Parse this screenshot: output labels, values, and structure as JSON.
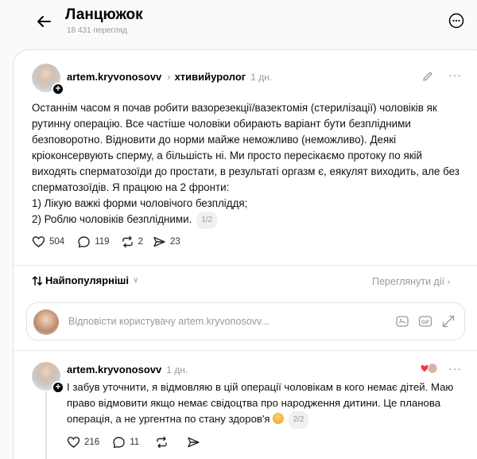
{
  "header": {
    "title": "Ланцюжок",
    "views": "18 431 перегляд"
  },
  "post": {
    "username": "artem.kryvonosovv",
    "topic": "хтивийуролог",
    "time": "1 дн.",
    "paragraphs": [
      "Останнім часом я почав робити вазорезекції/вазектомія (стерилізації) чоловіків як рутинну операцію. Все частіше чоловіки обирають варіант бути безплідними безповоротно. Відновити до норми майже неможливо (неможливо). Деякі кріоконсервують сперму, а більшість ні. Ми просто пересікаємо протоку по якій виходять сперматозоїди до простати, в результаті оргазм є, еякулят виходить, але без сперматозоїдів. Я працюю на 2 фронти:",
      "1) Лікую важкі форми чоловічого безпліддя;",
      "2) Роблю чоловіків безплідними."
    ],
    "pager": "1/2",
    "likes": "504",
    "comments": "119",
    "reposts": "2",
    "shares": "23"
  },
  "sort": {
    "label": "Найпопулярніші",
    "activity_link": "Переглянути дії"
  },
  "reply": {
    "placeholder": "Відповісти користувачу artem.kryvonosovv..."
  },
  "comment": {
    "username": "artem.kryvonosovv",
    "time": "1 дн.",
    "text": "І забув уточнити, я відмовляю в цій операції чоловікам в кого немає дітей. Маю право відмовити якщо немає свідоцтва про народження дитини. Це планова операція, а не ургентна по стану здоров'я",
    "pager": "2/2",
    "likes": "216",
    "comments": "11"
  },
  "icons": {
    "back": "arrow-left-icon",
    "more": "more-circle-icon",
    "edit": "pencil-icon",
    "like": "heart-icon",
    "comment": "comment-bubble-icon",
    "repost": "repost-icon",
    "share": "send-icon",
    "sort": "sort-arrows-icon",
    "image": "image-icon",
    "gif": "gif-icon",
    "expand": "expand-icon"
  }
}
